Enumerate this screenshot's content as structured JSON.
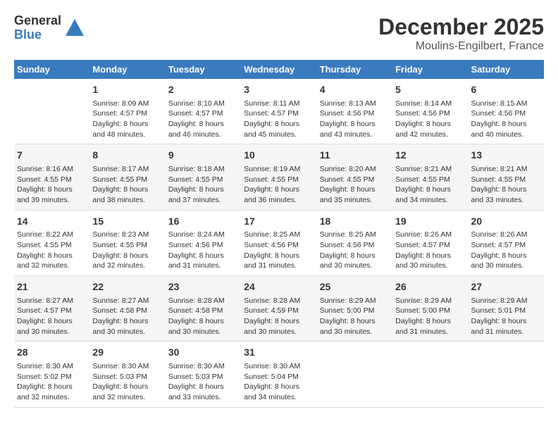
{
  "header": {
    "logo_line1": "General",
    "logo_line2": "Blue",
    "title": "December 2025",
    "subtitle": "Moulins-Engilbert, France"
  },
  "days_of_week": [
    "Sunday",
    "Monday",
    "Tuesday",
    "Wednesday",
    "Thursday",
    "Friday",
    "Saturday"
  ],
  "weeks": [
    [
      {
        "num": "",
        "info": ""
      },
      {
        "num": "1",
        "info": "Sunrise: 8:09 AM\nSunset: 4:57 PM\nDaylight: 8 hours\nand 48 minutes."
      },
      {
        "num": "2",
        "info": "Sunrise: 8:10 AM\nSunset: 4:57 PM\nDaylight: 8 hours\nand 46 minutes."
      },
      {
        "num": "3",
        "info": "Sunrise: 8:11 AM\nSunset: 4:57 PM\nDaylight: 8 hours\nand 45 minutes."
      },
      {
        "num": "4",
        "info": "Sunrise: 8:13 AM\nSunset: 4:56 PM\nDaylight: 8 hours\nand 43 minutes."
      },
      {
        "num": "5",
        "info": "Sunrise: 8:14 AM\nSunset: 4:56 PM\nDaylight: 8 hours\nand 42 minutes."
      },
      {
        "num": "6",
        "info": "Sunrise: 8:15 AM\nSunset: 4:56 PM\nDaylight: 8 hours\nand 40 minutes."
      }
    ],
    [
      {
        "num": "7",
        "info": "Sunrise: 8:16 AM\nSunset: 4:55 PM\nDaylight: 8 hours\nand 39 minutes."
      },
      {
        "num": "8",
        "info": "Sunrise: 8:17 AM\nSunset: 4:55 PM\nDaylight: 8 hours\nand 38 minutes."
      },
      {
        "num": "9",
        "info": "Sunrise: 8:18 AM\nSunset: 4:55 PM\nDaylight: 8 hours\nand 37 minutes."
      },
      {
        "num": "10",
        "info": "Sunrise: 8:19 AM\nSunset: 4:55 PM\nDaylight: 8 hours\nand 36 minutes."
      },
      {
        "num": "11",
        "info": "Sunrise: 8:20 AM\nSunset: 4:55 PM\nDaylight: 8 hours\nand 35 minutes."
      },
      {
        "num": "12",
        "info": "Sunrise: 8:21 AM\nSunset: 4:55 PM\nDaylight: 8 hours\nand 34 minutes."
      },
      {
        "num": "13",
        "info": "Sunrise: 8:21 AM\nSunset: 4:55 PM\nDaylight: 8 hours\nand 33 minutes."
      }
    ],
    [
      {
        "num": "14",
        "info": "Sunrise: 8:22 AM\nSunset: 4:55 PM\nDaylight: 8 hours\nand 32 minutes."
      },
      {
        "num": "15",
        "info": "Sunrise: 8:23 AM\nSunset: 4:55 PM\nDaylight: 8 hours\nand 32 minutes."
      },
      {
        "num": "16",
        "info": "Sunrise: 8:24 AM\nSunset: 4:56 PM\nDaylight: 8 hours\nand 31 minutes."
      },
      {
        "num": "17",
        "info": "Sunrise: 8:25 AM\nSunset: 4:56 PM\nDaylight: 8 hours\nand 31 minutes."
      },
      {
        "num": "18",
        "info": "Sunrise: 8:25 AM\nSunset: 4:56 PM\nDaylight: 8 hours\nand 30 minutes."
      },
      {
        "num": "19",
        "info": "Sunrise: 8:26 AM\nSunset: 4:57 PM\nDaylight: 8 hours\nand 30 minutes."
      },
      {
        "num": "20",
        "info": "Sunrise: 8:26 AM\nSunset: 4:57 PM\nDaylight: 8 hours\nand 30 minutes."
      }
    ],
    [
      {
        "num": "21",
        "info": "Sunrise: 8:27 AM\nSunset: 4:57 PM\nDaylight: 8 hours\nand 30 minutes."
      },
      {
        "num": "22",
        "info": "Sunrise: 8:27 AM\nSunset: 4:58 PM\nDaylight: 8 hours\nand 30 minutes."
      },
      {
        "num": "23",
        "info": "Sunrise: 8:28 AM\nSunset: 4:58 PM\nDaylight: 8 hours\nand 30 minutes."
      },
      {
        "num": "24",
        "info": "Sunrise: 8:28 AM\nSunset: 4:59 PM\nDaylight: 8 hours\nand 30 minutes."
      },
      {
        "num": "25",
        "info": "Sunrise: 8:29 AM\nSunset: 5:00 PM\nDaylight: 8 hours\nand 30 minutes."
      },
      {
        "num": "26",
        "info": "Sunrise: 8:29 AM\nSunset: 5:00 PM\nDaylight: 8 hours\nand 31 minutes."
      },
      {
        "num": "27",
        "info": "Sunrise: 8:29 AM\nSunset: 5:01 PM\nDaylight: 8 hours\nand 31 minutes."
      }
    ],
    [
      {
        "num": "28",
        "info": "Sunrise: 8:30 AM\nSunset: 5:02 PM\nDaylight: 8 hours\nand 32 minutes."
      },
      {
        "num": "29",
        "info": "Sunrise: 8:30 AM\nSunset: 5:03 PM\nDaylight: 8 hours\nand 32 minutes."
      },
      {
        "num": "30",
        "info": "Sunrise: 8:30 AM\nSunset: 5:03 PM\nDaylight: 8 hours\nand 33 minutes."
      },
      {
        "num": "31",
        "info": "Sunrise: 8:30 AM\nSunset: 5:04 PM\nDaylight: 8 hours\nand 34 minutes."
      },
      {
        "num": "",
        "info": ""
      },
      {
        "num": "",
        "info": ""
      },
      {
        "num": "",
        "info": ""
      }
    ]
  ]
}
